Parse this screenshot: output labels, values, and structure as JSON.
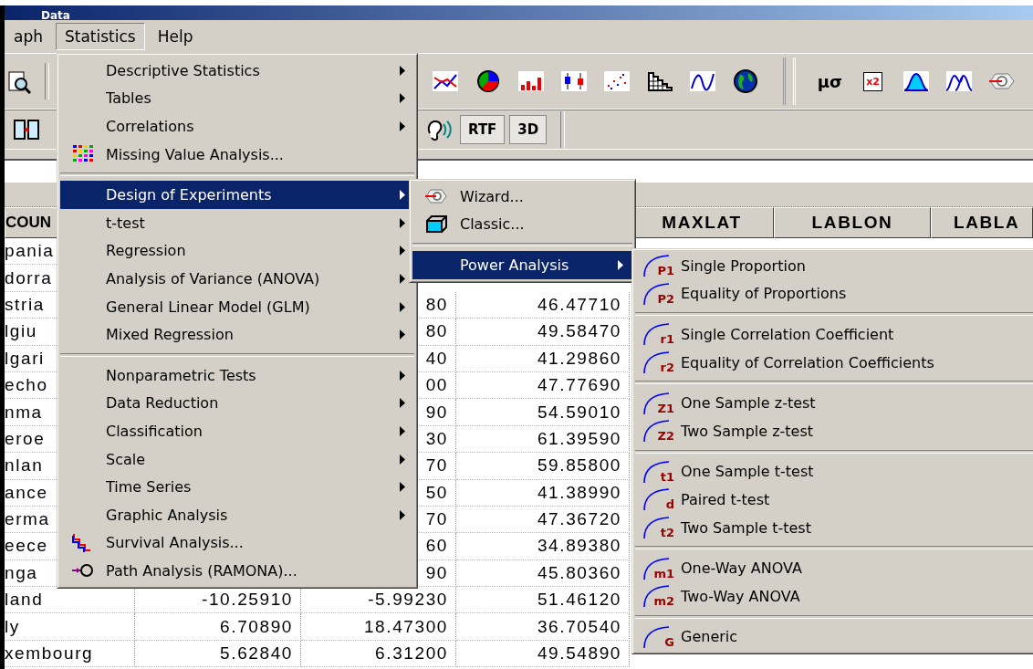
{
  "window": {
    "title": "Data"
  },
  "menubar": [
    {
      "label": "aph",
      "selected": false
    },
    {
      "label": "Statistics",
      "selected": true
    },
    {
      "label": "Help",
      "selected": false
    }
  ],
  "toolbar": {
    "row_1": [
      {
        "kind": "print-preview"
      },
      {
        "kind": "separator"
      },
      {
        "kind": "gap"
      },
      {
        "kind": "line-chart"
      },
      {
        "kind": "pie-chart"
      },
      {
        "kind": "bar-chart"
      },
      {
        "kind": "box-plot"
      },
      {
        "kind": "scatter-plot"
      },
      {
        "kind": "histogram"
      },
      {
        "kind": "curve"
      },
      {
        "kind": "globe"
      },
      {
        "kind": "double-separator"
      },
      {
        "kind": "mu-sigma",
        "label": "μσ"
      },
      {
        "kind": "table-x",
        "label": "x2"
      },
      {
        "kind": "bell-curve"
      },
      {
        "kind": "double-bell-curve"
      },
      {
        "kind": "target"
      }
    ],
    "row_2": [
      {
        "kind": "columns"
      },
      {
        "kind": "gap"
      },
      {
        "kind": "sound"
      },
      {
        "kind": "text-button",
        "label": "RTF"
      },
      {
        "kind": "text-button",
        "label": "3D"
      },
      {
        "kind": "separator"
      }
    ]
  },
  "table": {
    "header": {
      "column_1": "COUN",
      "column_5": "MAXLAT",
      "column_6": "LABLON",
      "column_7": "LABLA"
    },
    "rows": [
      {
        "column_1": "pania"
      },
      {
        "column_1": "dorra"
      },
      {
        "column_1": "stria",
        "column_3": "80",
        "column_4": "46.47710"
      },
      {
        "column_1": "lgiu",
        "column_3": "80",
        "column_4": "49.58470"
      },
      {
        "column_1": "lgari",
        "column_3": "40",
        "column_4": "41.29860"
      },
      {
        "column_1": "echo",
        "column_3": "00",
        "column_4": "47.77690"
      },
      {
        "column_1": "nma",
        "column_3": "90",
        "column_4": "54.59010"
      },
      {
        "column_1": "eroe",
        "column_3": "30",
        "column_4": "61.39590"
      },
      {
        "column_1": "nlan",
        "column_3": "70",
        "column_4": "59.85800"
      },
      {
        "column_1": "ance",
        "column_3": "50",
        "column_4": "41.38990"
      },
      {
        "column_1": "erma",
        "column_3": "70",
        "column_4": "47.36720"
      },
      {
        "column_1": "eece",
        "column_3": "60",
        "column_4": "34.89380"
      },
      {
        "column_1": "nga",
        "column_3": "90",
        "column_4": "45.80360"
      },
      {
        "column_1": "land",
        "column_2": "-10.25910",
        "column_3": "-5.99230",
        "column_4": "51.46120"
      },
      {
        "column_1": "ly",
        "column_2": "6.70890",
        "column_3": "18.47300",
        "column_4": "36.70540"
      },
      {
        "column_1": "xembourg",
        "column_2": "5.62840",
        "column_3": "6.31200",
        "column_4": "49.54890"
      }
    ]
  },
  "statistics_menu": {
    "groups": [
      [
        {
          "label": "Descriptive Statistics",
          "kind": "submenu",
          "selected": false
        },
        {
          "label": "Tables",
          "kind": "submenu",
          "selected": false
        },
        {
          "label": "Correlations",
          "kind": "submenu",
          "selected": false
        },
        {
          "label": "Missing Value Analysis...",
          "kind": "color-grid",
          "selected": false
        }
      ],
      [
        {
          "label": "Design of Experiments",
          "kind": "submenu",
          "selected": true
        },
        {
          "label": "t-test",
          "kind": "submenu",
          "selected": false
        },
        {
          "label": "Regression",
          "kind": "submenu",
          "selected": false
        },
        {
          "label": "Analysis of Variance (ANOVA)",
          "kind": "submenu",
          "selected": false
        },
        {
          "label": "General Linear Model (GLM)",
          "kind": "submenu",
          "selected": false
        },
        {
          "label": "Mixed Regression",
          "kind": "submenu",
          "selected": false
        }
      ],
      [
        {
          "label": "Nonparametric Tests",
          "kind": "submenu",
          "selected": false
        },
        {
          "label": "Data Reduction",
          "kind": "submenu",
          "selected": false
        },
        {
          "label": "Classification",
          "kind": "submenu",
          "selected": false
        },
        {
          "label": "Scale",
          "kind": "submenu",
          "selected": false
        },
        {
          "label": "Time Series",
          "kind": "submenu",
          "selected": false
        },
        {
          "label": "Graphic Analysis",
          "kind": "submenu",
          "selected": false
        },
        {
          "label": "Survival Analysis...",
          "kind": "step-lines",
          "selected": false
        },
        {
          "label": "Path Analysis (RAMONA)...",
          "kind": "arrow-circle",
          "selected": false
        }
      ]
    ]
  },
  "design_submenu": {
    "groups": [
      [
        {
          "label": "Wizard...",
          "kind": "target",
          "selected": false
        },
        {
          "label": "Classic...",
          "kind": "cube",
          "selected": false
        }
      ],
      [
        {
          "label": "Power Analysis",
          "kind": "submenu",
          "selected": true
        }
      ]
    ]
  },
  "power_submenu": {
    "groups": [
      [
        {
          "label": "Single Proportion",
          "kind": "arc",
          "selected": false,
          "icon_label": "P1"
        },
        {
          "label": "Equality of Proportions",
          "kind": "arc",
          "selected": false,
          "icon_label": "P2"
        }
      ],
      [
        {
          "label": "Single Correlation Coefficient",
          "kind": "arc",
          "selected": false,
          "icon_label": "r1"
        },
        {
          "label": "Equality of Correlation Coefficients",
          "kind": "arc",
          "selected": false,
          "icon_label": "r2"
        }
      ],
      [
        {
          "label": "One Sample z-test",
          "kind": "arc",
          "selected": false,
          "icon_label": "Z1"
        },
        {
          "label": "Two Sample z-test",
          "kind": "arc",
          "selected": false,
          "icon_label": "Z2"
        }
      ],
      [
        {
          "label": "One Sample t-test",
          "kind": "arc",
          "selected": false,
          "icon_label": "t1"
        },
        {
          "label": "Paired t-test",
          "kind": "arc",
          "selected": false,
          "icon_label": "d"
        },
        {
          "label": "Two Sample t-test",
          "kind": "arc",
          "selected": false,
          "icon_label": "t2"
        }
      ],
      [
        {
          "label": "One-Way ANOVA",
          "kind": "arc",
          "selected": false,
          "icon_label": "m1"
        },
        {
          "label": "Two-Way ANOVA",
          "kind": "arc",
          "selected": false,
          "icon_label": "m2"
        }
      ],
      [
        {
          "label": "Generic",
          "kind": "arc",
          "selected": false,
          "icon_label": "G"
        }
      ]
    ]
  }
}
